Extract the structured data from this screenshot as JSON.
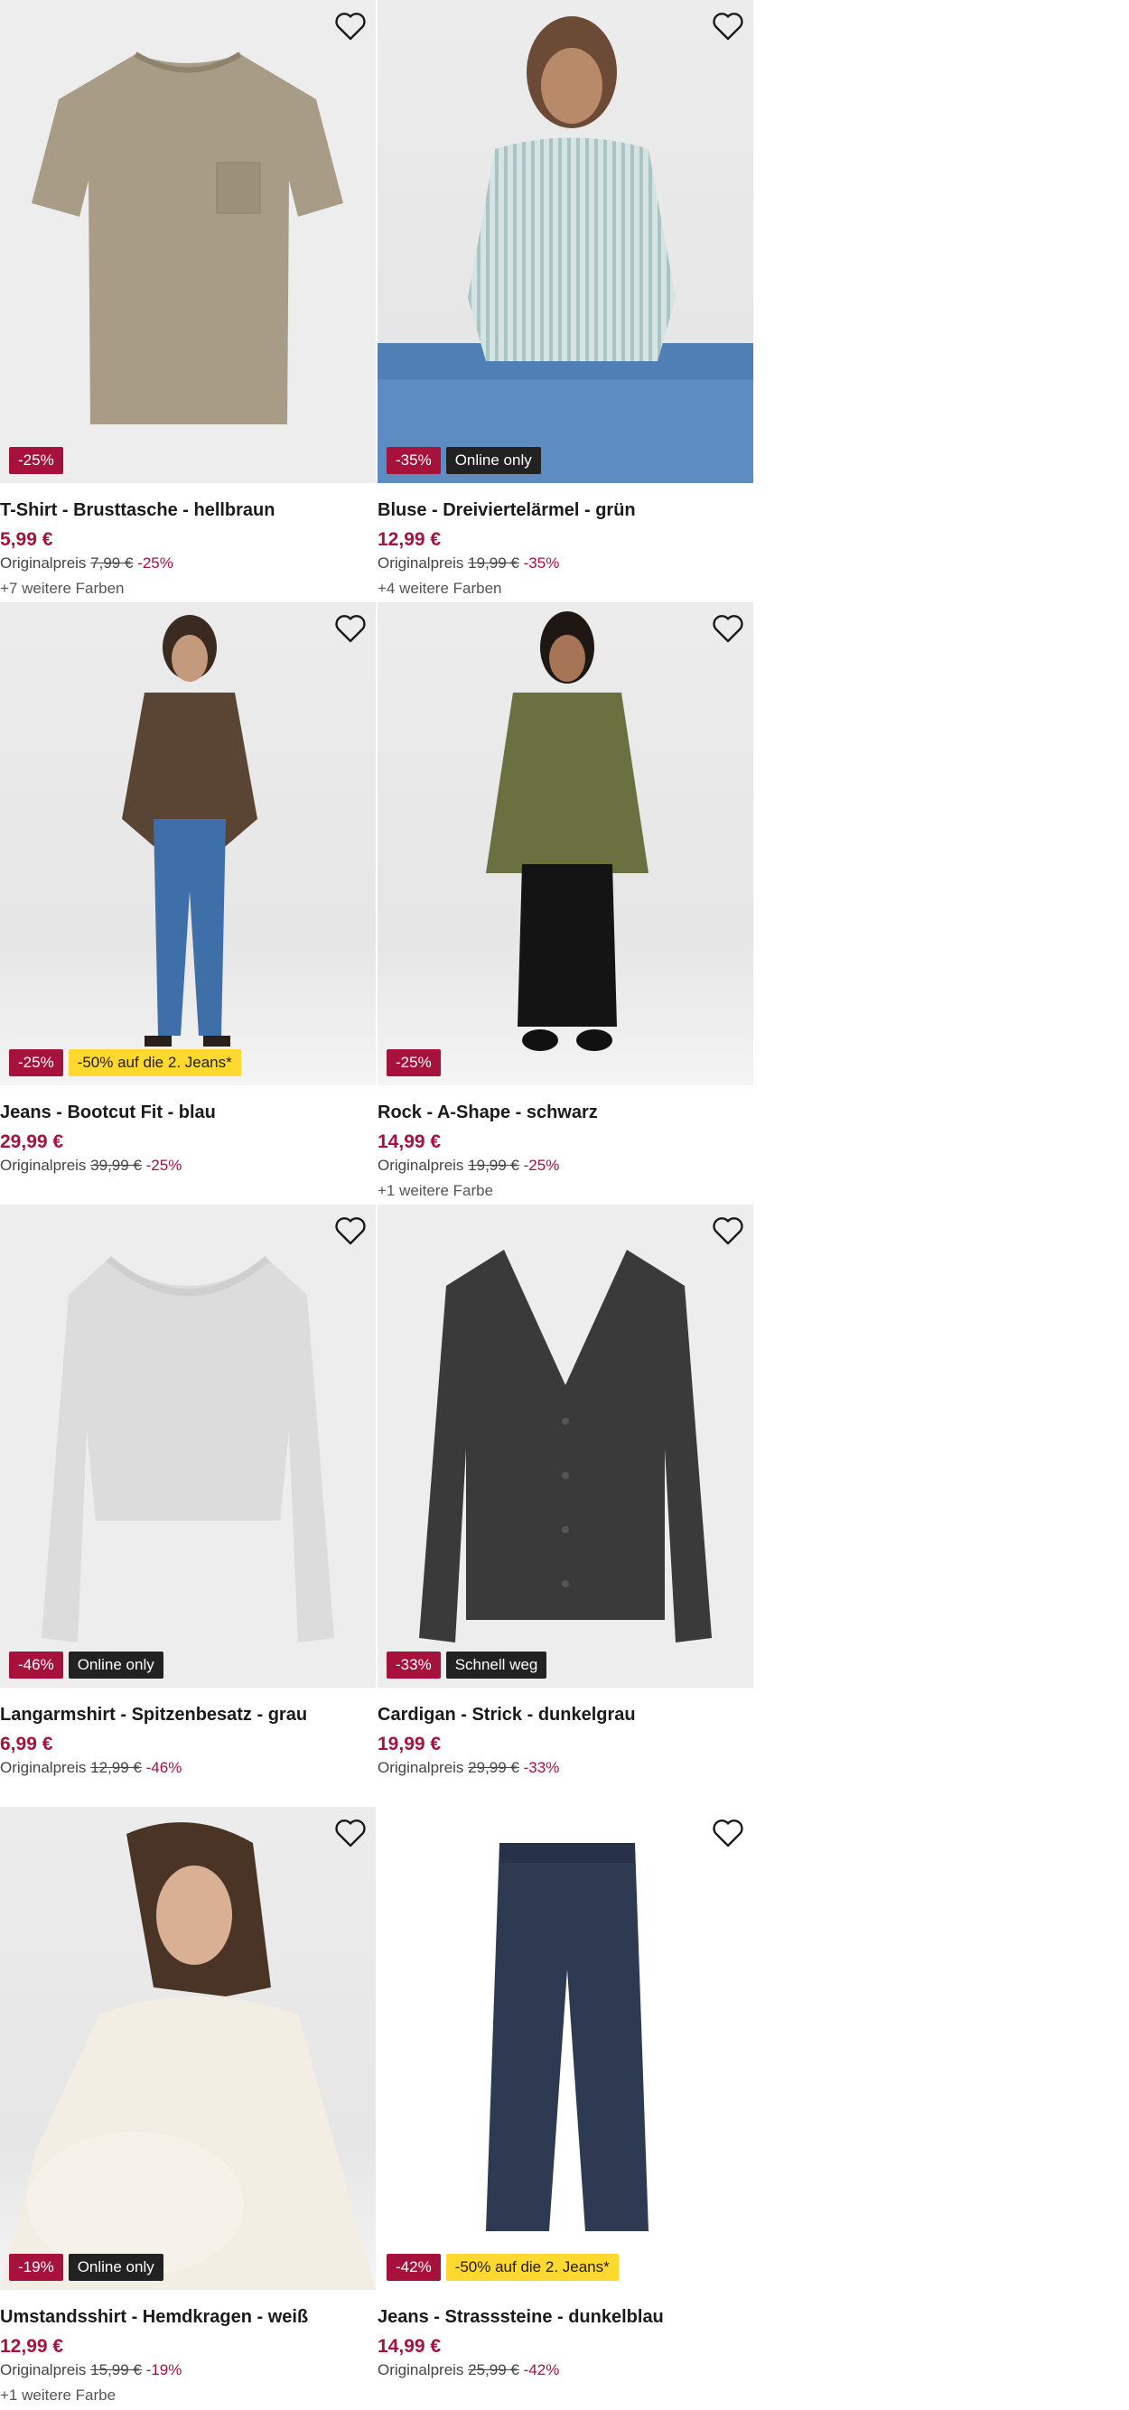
{
  "products": [
    {
      "title": "T-Shirt - Brusttasche - hellbraun",
      "price": "5,99 €",
      "orig_label": "Originalpreis",
      "orig_price": "7,99 €",
      "discount": "-25%",
      "badges": [
        {
          "text": "-25%",
          "kind": "sale"
        }
      ],
      "colors": "+7 weitere Farben",
      "image": "tshirt"
    },
    {
      "title": "Bluse - Dreiviertelärmel - grün",
      "price": "12,99 €",
      "orig_label": "Originalpreis",
      "orig_price": "19,99 €",
      "discount": "-35%",
      "badges": [
        {
          "text": "-35%",
          "kind": "sale"
        },
        {
          "text": "Online only",
          "kind": "dark"
        }
      ],
      "colors": "+4 weitere Farben",
      "image": "blouse"
    },
    {
      "title": "Jeans - Bootcut Fit - blau",
      "price": "29,99 €",
      "orig_label": "Originalpreis",
      "orig_price": "39,99 €",
      "discount": "-25%",
      "badges": [
        {
          "text": "-25%",
          "kind": "sale"
        },
        {
          "text": "-50% auf die 2. Jeans*",
          "kind": "yellow"
        }
      ],
      "colors": "",
      "image": "jeans-model"
    },
    {
      "title": "Rock - A-Shape - schwarz",
      "price": "14,99 €",
      "orig_label": "Originalpreis",
      "orig_price": "19,99 €",
      "discount": "-25%",
      "badges": [
        {
          "text": "-25%",
          "kind": "sale"
        }
      ],
      "colors": "+1 weitere Farbe",
      "image": "skirt-model"
    },
    {
      "title": "Langarmshirt - Spitzenbesatz - grau",
      "price": "6,99 €",
      "orig_label": "Originalpreis",
      "orig_price": "12,99 €",
      "discount": "-46%",
      "badges": [
        {
          "text": "-46%",
          "kind": "sale"
        },
        {
          "text": "Online only",
          "kind": "dark"
        }
      ],
      "colors": "",
      "image": "longsleeve"
    },
    {
      "title": "Cardigan - Strick - dunkelgrau",
      "price": "19,99 €",
      "orig_label": "Originalpreis",
      "orig_price": "29,99 €",
      "discount": "-33%",
      "badges": [
        {
          "text": "-33%",
          "kind": "sale"
        },
        {
          "text": "Schnell weg",
          "kind": "dark"
        }
      ],
      "colors": "",
      "image": "cardigan"
    },
    {
      "title": "Umstandsshirt - Hemdkragen - weiß",
      "price": "12,99 €",
      "orig_label": "Originalpreis",
      "orig_price": "15,99 €",
      "discount": "-19%",
      "badges": [
        {
          "text": "-19%",
          "kind": "sale"
        },
        {
          "text": "Online only",
          "kind": "dark"
        }
      ],
      "colors": "+1 weitere Farbe",
      "image": "maternity"
    },
    {
      "title": "Jeans - Strasssteine - dunkelblau",
      "price": "14,99 €",
      "orig_label": "Originalpreis",
      "orig_price": "25,99 €",
      "discount": "-42%",
      "badges": [
        {
          "text": "-42%",
          "kind": "sale"
        },
        {
          "text": "-50% auf die 2. Jeans*",
          "kind": "yellow"
        }
      ],
      "colors": "",
      "image": "jeans-flat"
    }
  ],
  "icons": {
    "favorite": "heart-outline-icon"
  },
  "colors": {
    "sale": "#a7123d",
    "badge_dark": "#222222",
    "badge_promo": "#ffd830"
  }
}
